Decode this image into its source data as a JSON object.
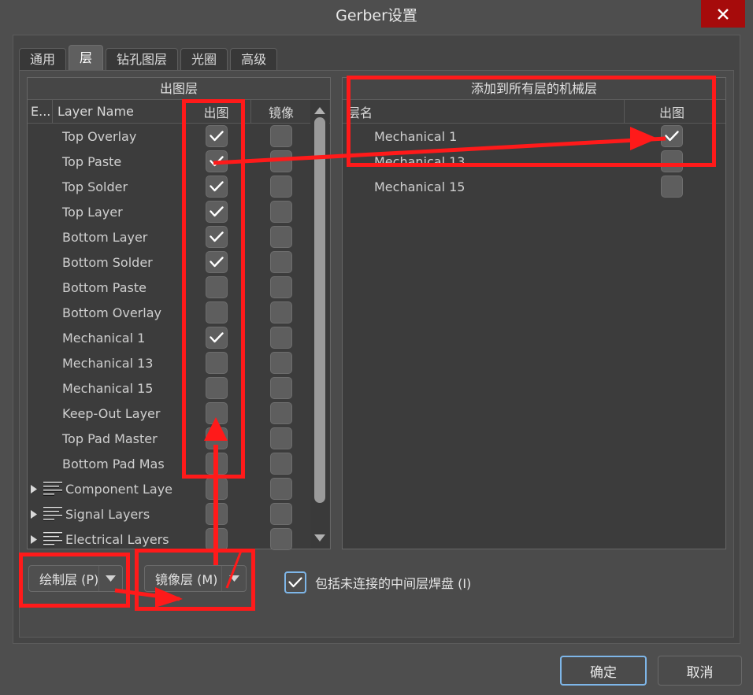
{
  "window": {
    "title": "Gerber设置",
    "close_icon": "close-icon"
  },
  "tabs": [
    {
      "label": "通用",
      "active": false
    },
    {
      "label": "层",
      "active": true
    },
    {
      "label": "钻孔图层",
      "active": false
    },
    {
      "label": "光圈",
      "active": false
    },
    {
      "label": "高级",
      "active": false
    }
  ],
  "left_panel": {
    "title": "出图层",
    "columns": [
      "E...",
      "Layer Name",
      "出图",
      "镜像"
    ],
    "rows": [
      {
        "name": "Top Overlay",
        "plot": true,
        "mirror": false,
        "group": false
      },
      {
        "name": "Top Paste",
        "plot": true,
        "mirror": false,
        "group": false
      },
      {
        "name": "Top Solder",
        "plot": true,
        "mirror": false,
        "group": false
      },
      {
        "name": "Top Layer",
        "plot": true,
        "mirror": false,
        "group": false
      },
      {
        "name": "Bottom Layer",
        "plot": true,
        "mirror": false,
        "group": false
      },
      {
        "name": "Bottom Solder",
        "plot": true,
        "mirror": false,
        "group": false
      },
      {
        "name": "Bottom Paste",
        "plot": false,
        "mirror": false,
        "group": false
      },
      {
        "name": "Bottom Overlay",
        "plot": false,
        "mirror": false,
        "group": false
      },
      {
        "name": "Mechanical 1",
        "plot": true,
        "mirror": false,
        "group": false
      },
      {
        "name": "Mechanical 13",
        "plot": false,
        "mirror": false,
        "group": false
      },
      {
        "name": "Mechanical 15",
        "plot": false,
        "mirror": false,
        "group": false
      },
      {
        "name": "Keep-Out Layer",
        "plot": false,
        "mirror": false,
        "group": false
      },
      {
        "name": "Top Pad Master",
        "plot": false,
        "mirror": false,
        "group": false
      },
      {
        "name": "Bottom Pad Mas",
        "plot": false,
        "mirror": false,
        "group": false
      },
      {
        "name": "Component Laye",
        "plot": false,
        "mirror": false,
        "group": true
      },
      {
        "name": "Signal Layers",
        "plot": false,
        "mirror": false,
        "group": true
      },
      {
        "name": "Electrical Layers",
        "plot": false,
        "mirror": false,
        "group": true
      }
    ],
    "scrollbar": {
      "up_icon": "scroll-up-icon",
      "down_icon": "scroll-down-icon"
    }
  },
  "right_panel": {
    "title": "添加到所有层的机械层",
    "columns": [
      "层名",
      "出图"
    ],
    "rows": [
      {
        "name": "Mechanical 1",
        "plot": true
      },
      {
        "name": "Mechanical 13",
        "plot": false
      },
      {
        "name": "Mechanical 15",
        "plot": false
      }
    ]
  },
  "bottom": {
    "plot_layers_dropdown": "绘制层 (P)",
    "mirror_layers_dropdown": "镜像层 (M)",
    "include_unconnected_label": "包括未连接的中间层焊盘 (I)",
    "include_unconnected_checked": true
  },
  "footer": {
    "ok_label": "确定",
    "cancel_label": "取消"
  },
  "colors": {
    "accent_red": "#ff1a1a",
    "close_red": "#a60b0b",
    "focus_blue": "#7eb6e8",
    "dialog_bg": "#4e4e4e",
    "panel_bg": "#3c3c3c"
  }
}
